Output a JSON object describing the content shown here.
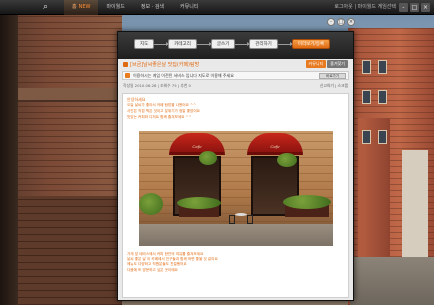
{
  "topbar": {
    "nav": [
      {
        "label": "홈",
        "active": true,
        "badge": "NEW"
      },
      {
        "label": "마이월드"
      },
      {
        "label": "정보 · 검색"
      },
      {
        "label": "커뮤니티"
      }
    ],
    "right_links": "로그아웃 | 마이월드 게임선택"
  },
  "modal": {
    "steps": [
      "지도",
      "카테고리",
      "글쓰기",
      "관리하기",
      "미리보기/등록"
    ],
    "active_step": 4,
    "post_title": "[브금]날씨좋은날 맛집(카페)탐방",
    "title_tags": [
      "커뮤니티",
      "즐겨찾기"
    ],
    "notice_text": "이용하시는 게임 이전된 서비스 입니다 지도로 이용해 주세요",
    "notice_button": "바로가기",
    "meta_left": "작성일 2010.06.28 | 조회수 75 | 추천 0",
    "meta_right": "신고하기 | 스크랩",
    "greeting": "안녕하세요",
    "intro_lines": [
      "오늘 날씨가 좋아서 카페 탐방을 나왔어요 ^^",
      "사진은 직접 찍은 것이고 분위기가 정말 좋았어요",
      "맛있는 커피와 디저트 함께 즐겨보세요 ^^"
    ],
    "outro_lines": [
      "가게 앞 테라스에서 커피 한잔의 여유를 즐겨보세요",
      "날씨 좋은 날 이 카페에서 친구들과 함께 하면 좋을 것 같아요",
      "메뉴도 다양하고 직원분들도 친절했어요",
      "다음에 또 방문하고 싶은 곳이에요"
    ],
    "photo_sign": "Cafe"
  },
  "window_controls": [
    "-",
    "□",
    "×"
  ]
}
